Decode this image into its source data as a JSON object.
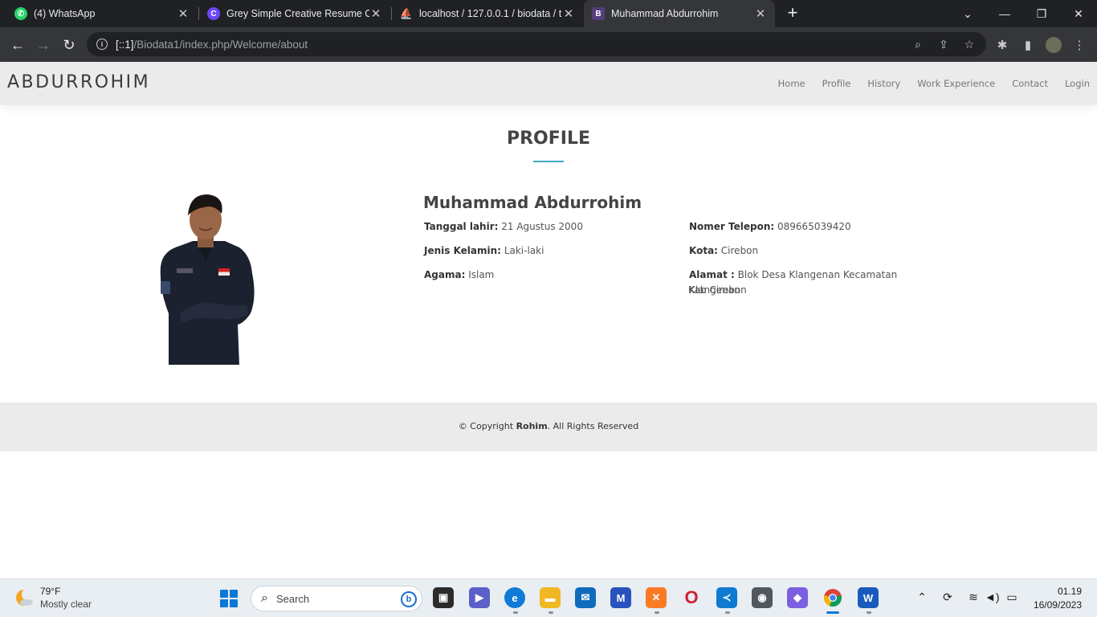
{
  "browser": {
    "tabs": [
      {
        "title": "(4) WhatsApp",
        "icon": "whatsapp-icon",
        "color": "#25d366",
        "glyph": "✆"
      },
      {
        "title": "Grey Simple Creative Resume CV",
        "icon": "canva-icon",
        "color": "#6c47ff",
        "glyph": "C"
      },
      {
        "title": "localhost / 127.0.0.1 / biodata / t",
        "icon": "phpmyadmin-icon",
        "color": "#f29111",
        "glyph": "⛵"
      },
      {
        "title": "Muhammad Abdurrohim",
        "icon": "bootstrap-icon",
        "color": "#563d7c",
        "glyph": "B"
      }
    ],
    "url_host": "[::1]",
    "url_path": "/Biodata1/index.php/Welcome/about"
  },
  "site": {
    "logo": "ABDURROHIM",
    "menu": [
      "Home",
      "Profile",
      "History",
      "Work Experience",
      "Contact",
      "Login"
    ],
    "section_title": "PROFILE",
    "name": "Muhammad Abdurrohim",
    "fields": {
      "birth_label": "Tanggal lahir:",
      "birth_value": "21 Agustus 2000",
      "gender_label": "Jenis Kelamin:",
      "gender_value": "Laki-laki",
      "religion_label": "Agama:",
      "religion_value": "Islam",
      "phone_label": "Nomer Telepon:",
      "phone_value": "089665039420",
      "city_label": "Kota:",
      "city_value": "Cirebon",
      "address_label": "Alamat :",
      "address_value": "Blok Desa Klangenan Kecamatan Klangenan",
      "address_value_2": "Kab Cirebon"
    },
    "footer": {
      "prefix": "© Copyright ",
      "owner": "Rohim",
      "suffix": ". All Rights Reserved"
    }
  },
  "taskbar": {
    "weather_temp": "79°F",
    "weather_desc": "Mostly clear",
    "search_label": "Search",
    "time": "01.19",
    "date": "16/09/2023"
  },
  "colors": {
    "accent": "#3fa9c4",
    "header_bg": "#ebebeb",
    "browser_bg": "#202124"
  }
}
